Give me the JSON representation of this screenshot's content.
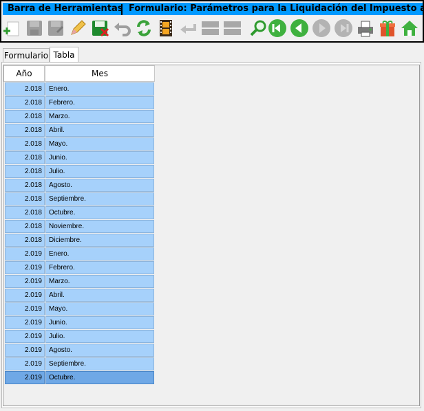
{
  "toolbar": {
    "title_left": "Barra de Herramientas",
    "title_right": "Formulario: Parámetros para la Liquidación del Impuesto a las G",
    "icons": [
      "new-icon",
      "save-icon",
      "save-as-icon",
      "edit-icon",
      "delete-icon",
      "undo-icon",
      "refresh-icon",
      "film-icon",
      "back-icon",
      "first-icon",
      "last-icon",
      "search-icon",
      "prev-page-icon",
      "prev-icon",
      "next-icon",
      "next-page-icon",
      "print-icon",
      "gift-icon",
      "home-icon"
    ]
  },
  "tabs": {
    "formulario": "Formulario",
    "tabla": "Tabla"
  },
  "table": {
    "columns": {
      "year": "Año",
      "month": "Mes"
    },
    "rows": [
      {
        "year": "2.018",
        "month": "Enero."
      },
      {
        "year": "2.018",
        "month": "Febrero."
      },
      {
        "year": "2.018",
        "month": "Marzo."
      },
      {
        "year": "2.018",
        "month": "Abril."
      },
      {
        "year": "2.018",
        "month": "Mayo."
      },
      {
        "year": "2.018",
        "month": "Junio."
      },
      {
        "year": "2.018",
        "month": "Julio."
      },
      {
        "year": "2.018",
        "month": "Agosto."
      },
      {
        "year": "2.018",
        "month": "Septiembre."
      },
      {
        "year": "2.018",
        "month": "Octubre."
      },
      {
        "year": "2.018",
        "month": "Noviembre."
      },
      {
        "year": "2.018",
        "month": "Diciembre."
      },
      {
        "year": "2.019",
        "month": "Enero."
      },
      {
        "year": "2.019",
        "month": "Febrero."
      },
      {
        "year": "2.019",
        "month": "Marzo."
      },
      {
        "year": "2.019",
        "month": "Abril."
      },
      {
        "year": "2.019",
        "month": "Mayo."
      },
      {
        "year": "2.019",
        "month": "Junio."
      },
      {
        "year": "2.019",
        "month": "Julio."
      },
      {
        "year": "2.019",
        "month": "Agosto."
      },
      {
        "year": "2.019",
        "month": "Septiembre."
      },
      {
        "year": "2.019",
        "month": "Octubre."
      }
    ],
    "selected_row": 21
  },
  "colors": {
    "title_bg": "#0099ff",
    "row_bg": "#a6d1fb",
    "row_selected_bg": "#6fa8e6"
  }
}
